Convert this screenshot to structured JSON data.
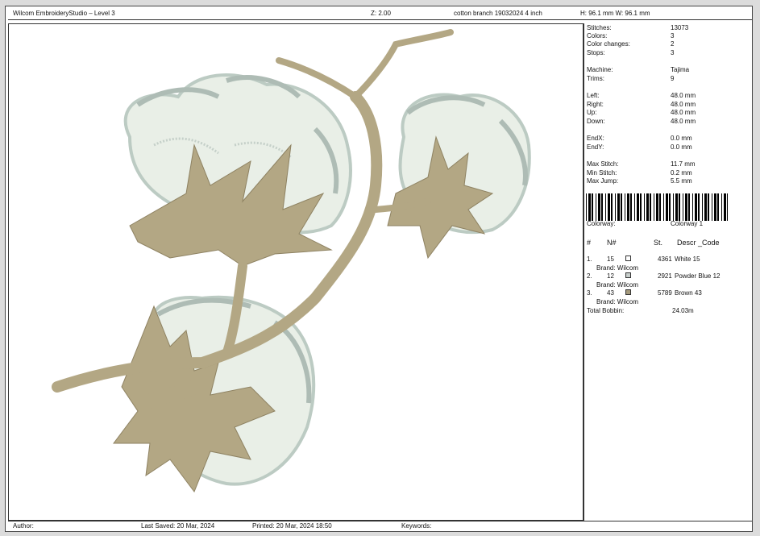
{
  "header": {
    "app_title": "Wilcom EmbroideryStudio – Level 3",
    "zoom": "Z: 2.00",
    "design_name": "cotton branch 19032024 4 inch",
    "dimensions": "H: 96.1 mm   W: 96.1 mm"
  },
  "stats": [
    {
      "label": "Stitches:",
      "value": "13073"
    },
    {
      "label": "Colors:",
      "value": "3"
    },
    {
      "label": "Color changes:",
      "value": "2"
    },
    {
      "label": "Stops:",
      "value": "3"
    },
    {
      "label": "Machine:",
      "value": "Tajima"
    },
    {
      "label": "Trims:",
      "value": "9"
    },
    {
      "label": "Left:",
      "value": "48.0 mm"
    },
    {
      "label": "Right:",
      "value": "48.0 mm"
    },
    {
      "label": "Up:",
      "value": "48.0 mm"
    },
    {
      "label": "Down:",
      "value": "48.0 mm"
    },
    {
      "label": "EndX:",
      "value": "0.0 mm"
    },
    {
      "label": "EndY:",
      "value": "0.0 mm"
    },
    {
      "label": "Max Stitch:",
      "value": "11.7 mm"
    },
    {
      "label": "Min Stitch:",
      "value": "0.2 mm"
    },
    {
      "label": "Max Jump:",
      "value": "5.5 mm"
    }
  ],
  "colorway": {
    "label": "Colorway:",
    "value": "Colorway 1"
  },
  "thread_table": {
    "col_num": "#",
    "col_n": "N#",
    "col_st": "St.",
    "col_desc": "Descr _Code",
    "rows": [
      {
        "num": "1.",
        "n": "15",
        "swatch": "#ffffff",
        "st": "4361",
        "desc": "White 15",
        "brand": "Brand: Wilcom"
      },
      {
        "num": "2.",
        "n": "12",
        "swatch": "#c8cfcc",
        "st": "2921",
        "desc": "Powder Blue 12",
        "brand": "Brand: Wilcom"
      },
      {
        "num": "3.",
        "n": "43",
        "swatch": "#a59a7c",
        "st": "5789",
        "desc": "Brown 43",
        "brand": "Brand: Wilcom"
      }
    ],
    "total_bobbin_label": "Total Bobbin:",
    "total_bobbin_value": "24.03m"
  },
  "footer": {
    "author": "Author:",
    "last_saved": "Last Saved: 20 Mar, 2024",
    "printed": "Printed: 20 Mar, 2024 18:50",
    "keywords": "Keywords:"
  },
  "colors": {
    "thread_brown": "#b3a784",
    "thread_brown_dark": "#8e8262",
    "thread_white": "#e8eee6",
    "thread_powder": "#bccbc3"
  }
}
